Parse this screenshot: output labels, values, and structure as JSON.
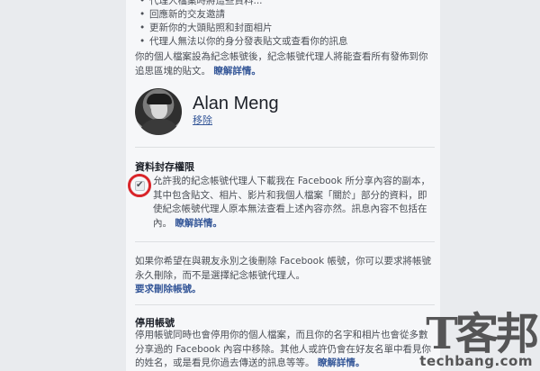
{
  "bullets": [
    "代理人檔案時將這些資料...",
    "回應新的交友邀請",
    "更新你的大頭貼照和封面相片",
    "代理人無法以你的身分發表貼文或查看你的訊息"
  ],
  "memorial_intro": {
    "text": "你的個人檔案設為紀念帳號後，紀念帳號代理人將能查看所有發佈到你追思區塊的貼文。",
    "link": "瞭解詳情。"
  },
  "legacy_contact": {
    "name": "Alan Meng",
    "remove_label": "移除"
  },
  "data_archive": {
    "heading": "資料封存權限",
    "text": "允許我的紀念帳號代理人下載我在 Facebook 所分享內容的副本，其中包含貼文、相片、影片和我個人檔案「關於」部分的資料，即使紀念帳號代理人原本無法查看上述內容亦然。訊息內容不包括在內。",
    "link": "瞭解詳情。",
    "checked": true
  },
  "delete_after": {
    "text": "如果你希望在與親友永別之後刪除 Facebook 帳號，你可以要求將帳號永久刪除，而不是選擇紀念帳號代理人。",
    "link": "要求刪除帳號。"
  },
  "deactivate": {
    "heading": "停用帳號",
    "text": "停用帳號同時也會停用你的個人檔案，而且你的名字和相片也會從多數分享過的 Facebook 內容中移除。其他人或許仍會在好友名單中看見你的姓名，或是看見你過去傳送的訊息等等。",
    "link": "瞭解詳情。"
  },
  "watermark": {
    "main": "T客邦",
    "sub": "techbang.com"
  }
}
